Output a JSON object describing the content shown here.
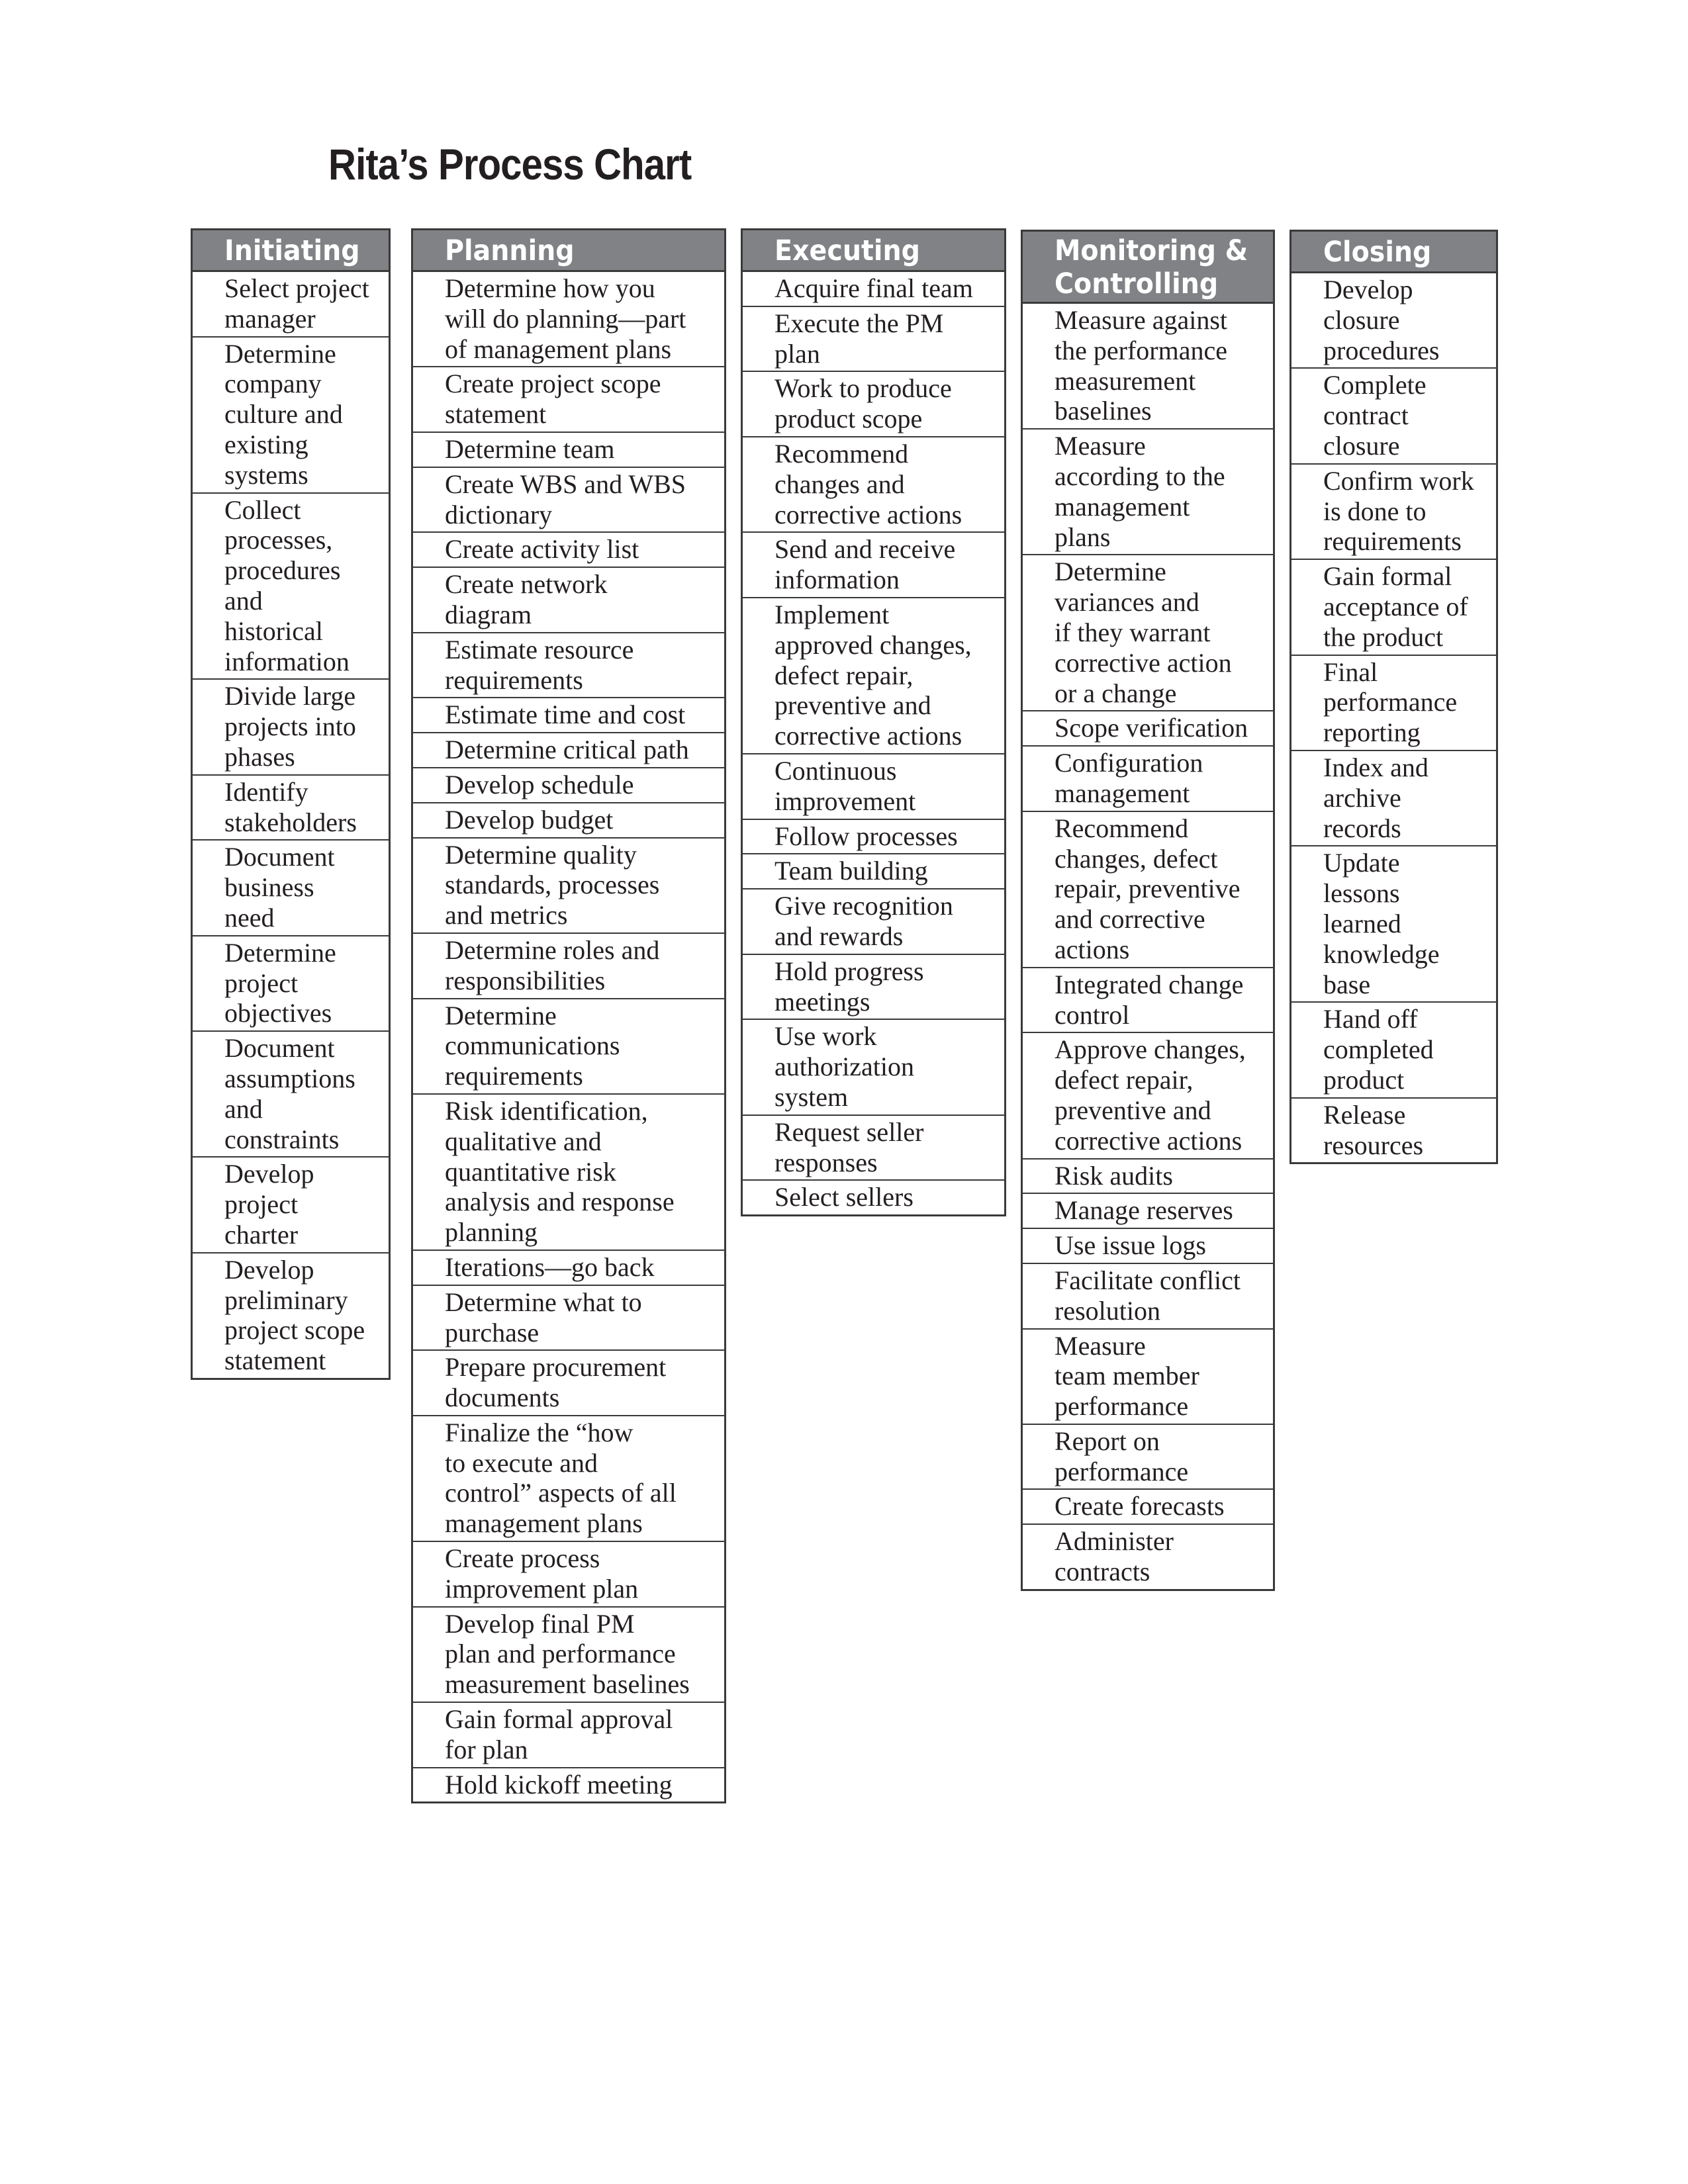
{
  "title": "Rita’s Process Chart",
  "columns": [
    {
      "id": "initiating",
      "header": "Initiating",
      "items": [
        "Select project\nmanager",
        "Determine\ncompany\nculture and\nexisting\nsystems",
        "Collect\nprocesses,\nprocedures\nand\nhistorical\ninformation",
        "Divide large\nprojects into\nphases",
        "Identify\nstakeholders",
        "Document\nbusiness\nneed",
        "Determine\nproject\nobjectives",
        "Document\nassumptions\nand\nconstraints",
        "Develop\nproject\ncharter",
        "Develop\npreliminary\nproject scope\nstatement"
      ]
    },
    {
      "id": "planning",
      "header": "Planning",
      "items": [
        "Determine how you\nwill do planning—part\nof management plans",
        "Create project scope\nstatement",
        "Determine team",
        "Create WBS and WBS\ndictionary",
        "Create activity list",
        "Create network\ndiagram",
        "Estimate resource\nrequirements",
        "Estimate time and cost",
        "Determine critical path",
        "Develop schedule",
        "Develop budget",
        "Determine quality\nstandards, processes\nand metrics",
        "Determine roles and\nresponsibilities",
        "Determine\ncommunications\nrequirements",
        "Risk identification,\nqualitative and\nquantitative risk\nanalysis and response\nplanning",
        "Iterations—go back",
        "Determine what to\npurchase",
        "Prepare procurement\ndocuments",
        "Finalize the “how\nto execute and\ncontrol” aspects of all\nmanagement plans",
        "Create process\nimprovement plan",
        "Develop final PM\nplan and performance\nmeasurement baselines",
        "Gain formal approval\nfor plan",
        "Hold kickoff meeting"
      ]
    },
    {
      "id": "executing",
      "header": "Executing",
      "items": [
        "Acquire final team",
        "Execute the PM\nplan",
        "Work to produce\nproduct scope",
        "Recommend\nchanges and\ncorrective actions",
        "Send and receive\ninformation",
        "Implement\napproved changes,\ndefect repair,\npreventive and\ncorrective actions",
        "Continuous\nimprovement",
        "Follow processes",
        "Team building",
        "Give recognition\nand rewards",
        "Hold progress\nmeetings",
        "Use work\nauthorization\nsystem",
        "Request seller\nresponses",
        "Select sellers"
      ]
    },
    {
      "id": "monitoring",
      "header": "Monitoring &\nControlling",
      "items": [
        "Measure against\nthe performance\nmeasurement\nbaselines",
        "Measure\naccording to the\nmanagement\nplans",
        "Determine\nvariances and\nif they warrant\ncorrective action\nor a change",
        "Scope verification",
        "Configuration\nmanagement",
        "Recommend\nchanges, defect\nrepair, preventive\nand corrective\nactions",
        "Integrated change\ncontrol",
        "Approve changes,\ndefect repair,\npreventive and\ncorrective actions",
        "Risk audits",
        "Manage reserves",
        "Use issue logs",
        "Facilitate conflict\nresolution",
        "Measure\nteam member\nperformance",
        "Report on\nperformance",
        "Create forecasts",
        "Administer\ncontracts"
      ]
    },
    {
      "id": "closing",
      "header": "Closing",
      "items": [
        "Develop\nclosure\nprocedures",
        "Complete\ncontract\nclosure",
        "Confirm work\nis done to\nrequirements",
        "Gain formal\nacceptance of\nthe product",
        "Final\nperformance\nreporting",
        "Index and\narchive\nrecords",
        "Update\nlessons\nlearned\nknowledge\nbase",
        "Hand off\ncompleted\nproduct",
        "Release\nresources"
      ]
    }
  ],
  "colors": {
    "header_bg": "#808285",
    "header_text": "#ffffff",
    "border": "#3a3a3a",
    "text": "#231f20"
  }
}
